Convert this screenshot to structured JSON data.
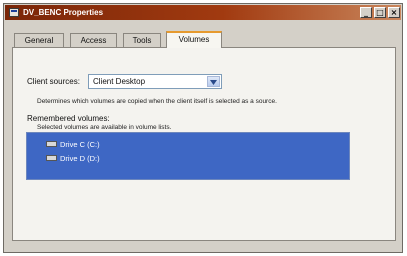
{
  "window": {
    "title": "DV_BENC Properties",
    "controls": {
      "minimize": "_",
      "maximize": "□",
      "close": "×"
    }
  },
  "tabs": [
    {
      "label": "General",
      "active": false
    },
    {
      "label": "Access",
      "active": false
    },
    {
      "label": "Tools",
      "active": false
    },
    {
      "label": "Volumes",
      "active": true
    }
  ],
  "client_sources": {
    "label": "Client sources:",
    "selected": "Client Desktop",
    "description": "Determines which volumes are copied when the client itself is selected as a source."
  },
  "remembered_volumes": {
    "label": "Remembered volumes:",
    "description": "Selected volumes are available in volume lists.",
    "items": [
      {
        "label": "Drive C (C:)",
        "icon": "drive-icon"
      },
      {
        "label": "Drive D (D:)",
        "icon": "drive-icon"
      }
    ]
  },
  "colors": {
    "titlebar": "#7a2608",
    "selection": "#3e67c4",
    "active_tab_accent": "#e69a2e"
  }
}
